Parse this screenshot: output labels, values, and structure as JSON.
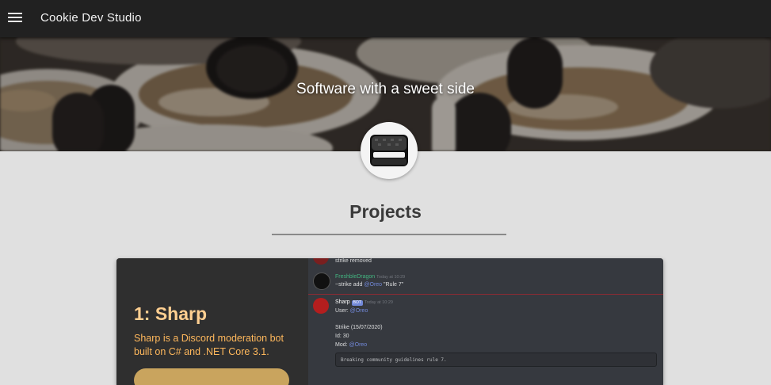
{
  "appbar": {
    "title": "Cookie Dev Studio",
    "menu_icon": "hamburger-menu-icon"
  },
  "hero": {
    "tagline": "Software with a sweet side"
  },
  "avatar": {
    "icon": "cookie-logo-icon"
  },
  "projects": {
    "heading": "Projects",
    "items": [
      {
        "title": "1: Sharp",
        "description": "Sharp is a Discord moderation bot built on C# and .NET Core 3.1.",
        "screenshot": {
          "top_line": "strike removed",
          "messages": [
            {
              "author": "FreshbleDragon",
              "timestamp": "Today at 10:29",
              "lines": [
                {
                  "prefix": "~strike add ",
                  "mention": "@Oreo",
                  "suffix": " \"Rule 7\""
                }
              ]
            },
            {
              "author": "Sharp",
              "bot_tag": "BOT",
              "timestamp": "Today at 10:29",
              "lines": [
                {
                  "prefix": "User: ",
                  "mention": "@Oreo",
                  "suffix": ""
                },
                {
                  "prefix": "Strike (15/07/2020)",
                  "mention": "",
                  "suffix": ""
                },
                {
                  "prefix": "Id: 30",
                  "mention": "",
                  "suffix": ""
                },
                {
                  "prefix": "Mod: ",
                  "mention": "@Oreo",
                  "suffix": ""
                }
              ],
              "code": "Breaking community guidelines rule 7."
            }
          ]
        }
      }
    ]
  },
  "colors": {
    "appbar": "#212121",
    "page_bg": "#e0e0e0",
    "card_bg": "#2f2f2f",
    "card_title": "#ffcf91",
    "card_desc": "#ffb85c",
    "button": "#c9a45e"
  }
}
